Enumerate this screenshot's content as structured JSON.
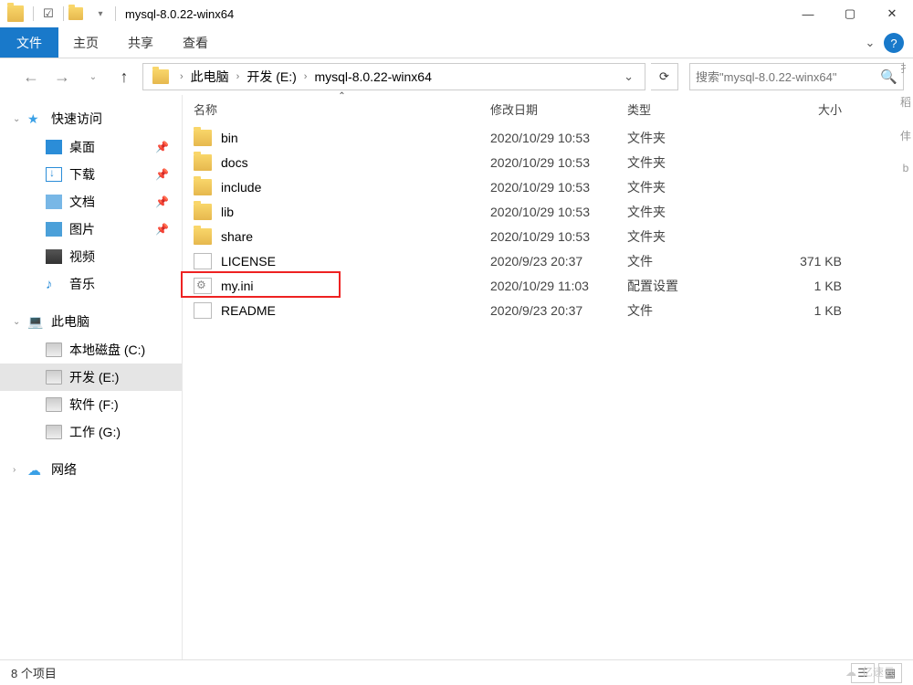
{
  "window": {
    "title": "mysql-8.0.22-winx64"
  },
  "ribbon": {
    "file": "文件",
    "tabs": [
      "主页",
      "共享",
      "查看"
    ]
  },
  "breadcrumbs": {
    "items": [
      "此电脑",
      "开发 (E:)",
      "mysql-8.0.22-winx64"
    ]
  },
  "search": {
    "placeholder": "搜索\"mysql-8.0.22-winx64\""
  },
  "sidebar": {
    "quick": {
      "label": "快速访问",
      "items": [
        {
          "label": "桌面",
          "pinned": true
        },
        {
          "label": "下载",
          "pinned": true
        },
        {
          "label": "文档",
          "pinned": true
        },
        {
          "label": "图片",
          "pinned": true
        },
        {
          "label": "视频",
          "pinned": false
        },
        {
          "label": "音乐",
          "pinned": false
        }
      ]
    },
    "thispc": {
      "label": "此电脑",
      "drives": [
        {
          "label": "本地磁盘 (C:)"
        },
        {
          "label": "开发 (E:)"
        },
        {
          "label": "软件 (F:)"
        },
        {
          "label": "工作 (G:)"
        }
      ]
    },
    "network": {
      "label": "网络"
    }
  },
  "columns": {
    "name": "名称",
    "date": "修改日期",
    "type": "类型",
    "size": "大小"
  },
  "files": [
    {
      "name": "bin",
      "date": "2020/10/29 10:53",
      "type": "文件夹",
      "size": "",
      "kind": "folder"
    },
    {
      "name": "docs",
      "date": "2020/10/29 10:53",
      "type": "文件夹",
      "size": "",
      "kind": "folder"
    },
    {
      "name": "include",
      "date": "2020/10/29 10:53",
      "type": "文件夹",
      "size": "",
      "kind": "folder"
    },
    {
      "name": "lib",
      "date": "2020/10/29 10:53",
      "type": "文件夹",
      "size": "",
      "kind": "folder"
    },
    {
      "name": "share",
      "date": "2020/10/29 10:53",
      "type": "文件夹",
      "size": "",
      "kind": "folder"
    },
    {
      "name": "LICENSE",
      "date": "2020/9/23 20:37",
      "type": "文件",
      "size": "371 KB",
      "kind": "file"
    },
    {
      "name": "my.ini",
      "date": "2020/10/29 11:03",
      "type": "配置设置",
      "size": "1 KB",
      "kind": "ini",
      "highlighted": true
    },
    {
      "name": "README",
      "date": "2020/9/23 20:37",
      "type": "文件",
      "size": "1 KB",
      "kind": "file"
    }
  ],
  "status": {
    "count": "8 个项目"
  },
  "watermark": "亿速云"
}
